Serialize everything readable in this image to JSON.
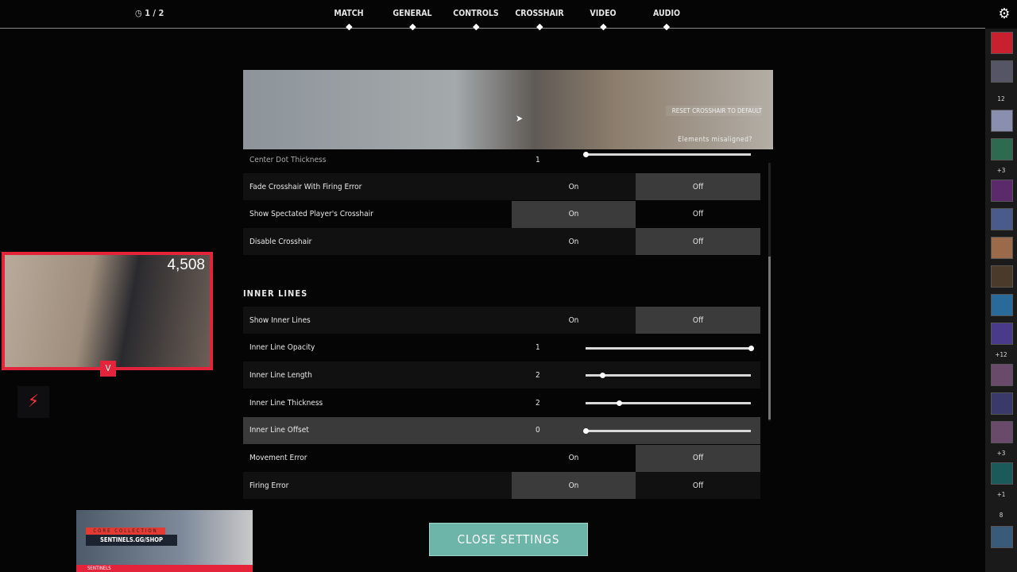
{
  "header": {
    "timer": "1 / 2",
    "tabs": [
      "MATCH",
      "GENERAL",
      "CONTROLS",
      "CROSSHAIR",
      "VIDEO",
      "AUDIO"
    ],
    "settings_icon": "gear-icon"
  },
  "preview": {
    "reset_label": "RESET CROSSHAIR TO DEFAULT",
    "misaligned_label": "Elements misaligned?"
  },
  "settings": {
    "partial_row": {
      "label": "Center Dot Thickness",
      "value": "1"
    },
    "rows_top": [
      {
        "label": "Fade Crosshair With Firing Error",
        "type": "toggle",
        "on": "On",
        "off": "Off",
        "selected": "Off"
      },
      {
        "label": "Show Spectated Player's Crosshair",
        "type": "toggle",
        "on": "On",
        "off": "Off",
        "selected": "On"
      },
      {
        "label": "Disable Crosshair",
        "type": "toggle",
        "on": "On",
        "off": "Off",
        "selected": "Off"
      }
    ],
    "section_title": "INNER LINES",
    "rows_inner": [
      {
        "label": "Show Inner Lines",
        "type": "toggle",
        "on": "On",
        "off": "Off",
        "selected": "Off"
      },
      {
        "label": "Inner Line Opacity",
        "type": "slider",
        "value": "1",
        "fraction": 1.0
      },
      {
        "label": "Inner Line Length",
        "type": "slider",
        "value": "2",
        "fraction": 0.1
      },
      {
        "label": "Inner Line Thickness",
        "type": "slider",
        "value": "2",
        "fraction": 0.2
      },
      {
        "label": "Inner Line Offset",
        "type": "slider",
        "value": "0",
        "fraction": 0.0,
        "highlighted": true
      },
      {
        "label": "Movement Error",
        "type": "toggle",
        "on": "On",
        "off": "Off",
        "selected": "Off"
      },
      {
        "label": "Firing Error",
        "type": "toggle",
        "on": "On",
        "off": "Off",
        "selected": "On"
      }
    ]
  },
  "close_button": "CLOSE SETTINGS",
  "stream": {
    "viewer_count": "4,508",
    "promo_line1": "CORE COLLECTION",
    "promo_line2": "SENTINELS.GG/SHOP",
    "promo_brand": "SENTINELS"
  },
  "sidebar": {
    "counts": [
      "12",
      "+3",
      "+12",
      "+3",
      "+1",
      "8"
    ]
  },
  "colors": {
    "accent": "#e3243b",
    "close_button": "#6db5a8",
    "selected_segment": "#3b3b3b"
  }
}
